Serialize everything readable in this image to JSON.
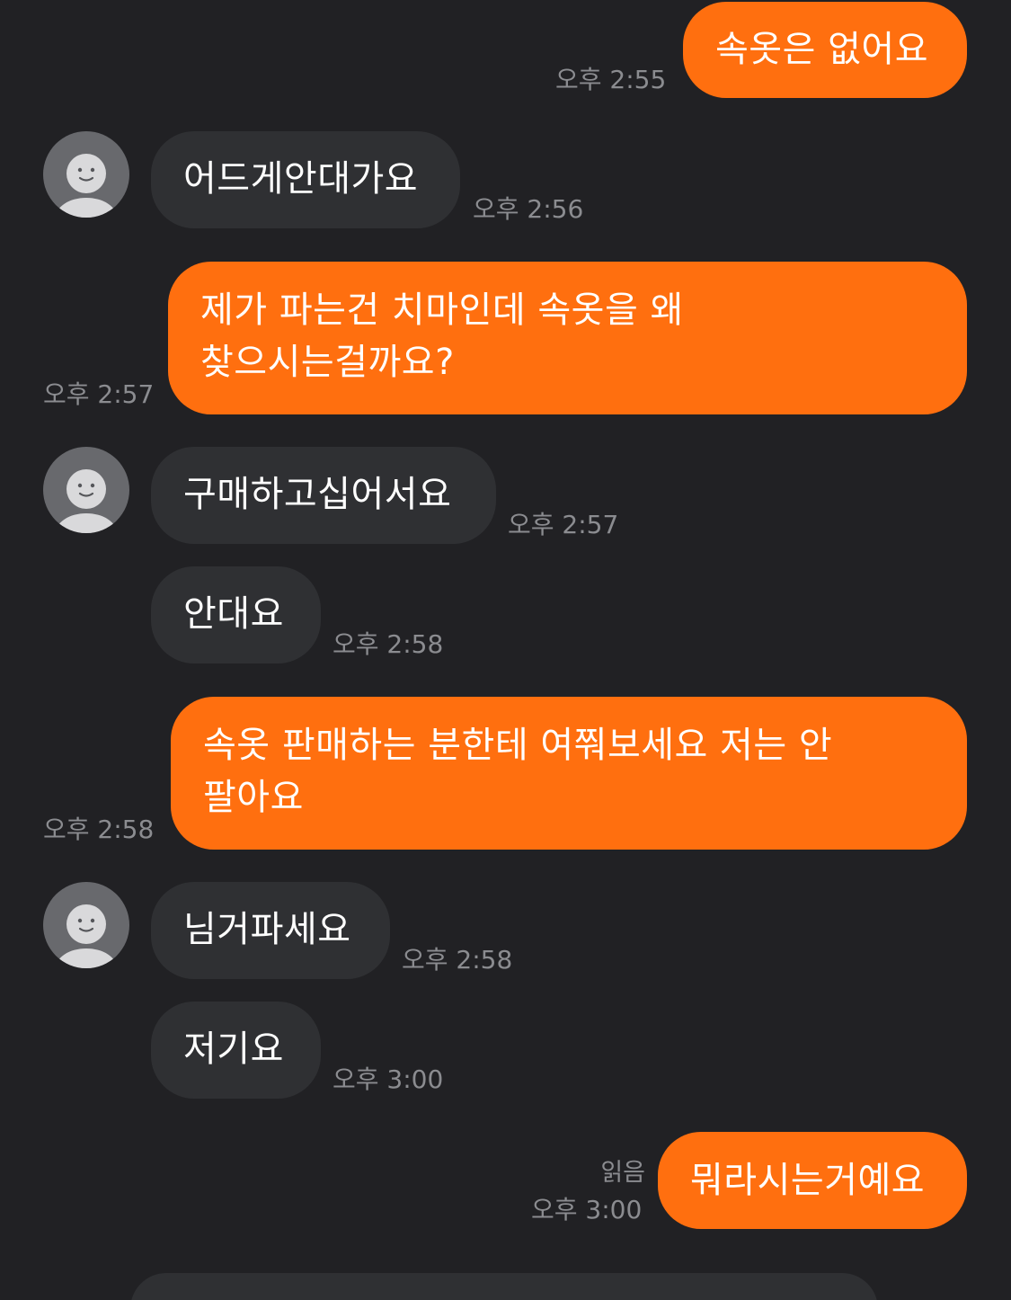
{
  "messages": [
    {
      "side": "me",
      "text": "속옷은 없어요",
      "time": "오후 2:55"
    },
    {
      "side": "them",
      "text": "어드게안대가요",
      "time": "오후 2:56"
    },
    {
      "side": "me",
      "text": "제가 파는건 치마인데 속옷을 왜 찾으시는걸까요?",
      "time": "오후 2:57"
    },
    {
      "side": "them",
      "text": "구매하고십어서요",
      "time": "오후 2:57"
    },
    {
      "side": "them",
      "text": "안대요",
      "time": "오후 2:58"
    },
    {
      "side": "me",
      "text": "속옷 판매하는 분한테 여쭤보세요 저는 안 팔아요",
      "time": "오후 2:58"
    },
    {
      "side": "them",
      "text": "님거파세요",
      "time": "오후 2:58"
    },
    {
      "side": "them",
      "text": "저기요",
      "time": "오후 3:00"
    },
    {
      "side": "me",
      "text": "뭐라시는거예요",
      "time": "오후 3:00",
      "status": "읽음"
    }
  ],
  "colors": {
    "background": "#212124",
    "my_bubble": "#ff6f0f",
    "their_bubble": "#2f3033",
    "timestamp": "#8b8c90",
    "avatar": "#68696d"
  },
  "icons": {
    "avatar": "default-profile-smiley-icon"
  }
}
